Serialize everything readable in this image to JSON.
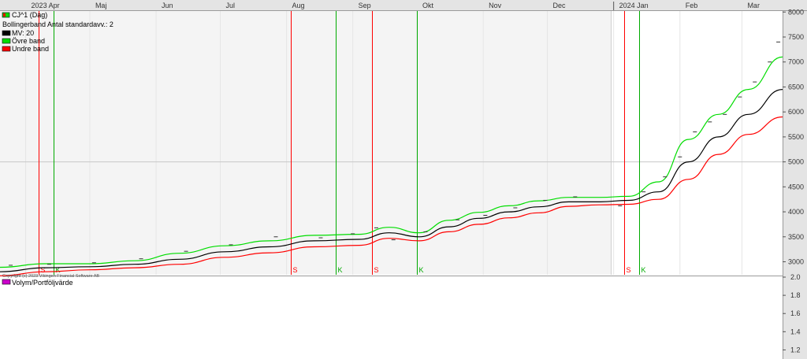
{
  "chart_data": {
    "type": "line",
    "time_axis": {
      "labels": [
        "2023 Apr",
        "Maj",
        "Jun",
        "Jul",
        "Aug",
        "Sep",
        "Okt",
        "Nov",
        "Dec",
        "2024 Jan",
        "Feb",
        "Mar"
      ],
      "label_dates": [
        "2023-04-01",
        "2023-05-01",
        "2023-06-01",
        "2023-07-01",
        "2023-08-01",
        "2023-09-01",
        "2023-10-01",
        "2023-11-01",
        "2023-12-01",
        "2024-01-01",
        "2024-02-01",
        "2024-03-01"
      ],
      "range": [
        "2023-03-20",
        "2024-03-20"
      ]
    },
    "main_panel": {
      "y_ticks": [
        3000,
        3500,
        4000,
        4500,
        5000,
        5500,
        6000,
        6500,
        7000,
        7500,
        8000
      ],
      "ylim": [
        2740,
        8020
      ],
      "reference_line": 5000,
      "legend": {
        "instrument": "CJ^1 (Dag)",
        "indicator": "Bollingerband  Antal standardavv.: 2",
        "entries": [
          {
            "label": "MV: 20",
            "color": "#000000"
          },
          {
            "label": "Övre band",
            "color": "#00dd00"
          },
          {
            "label": "Undre band",
            "color": "#ff0000"
          }
        ]
      },
      "copyright": "Copyright (c) 2023 Vikingen Financial Software AB",
      "series": {
        "x": [
          "2023-03-20",
          "2023-04-10",
          "2023-05-01",
          "2023-05-22",
          "2023-06-12",
          "2023-07-03",
          "2023-07-24",
          "2023-08-14",
          "2023-09-04",
          "2023-09-18",
          "2023-10-02",
          "2023-10-16",
          "2023-10-30",
          "2023-11-13",
          "2023-11-27",
          "2023-12-11",
          "2023-12-25",
          "2024-01-08",
          "2024-01-22",
          "2024-02-05",
          "2024-02-19",
          "2024-03-04",
          "2024-03-20"
        ],
        "mv": [
          2800,
          2880,
          2900,
          2950,
          3050,
          3200,
          3300,
          3420,
          3450,
          3580,
          3500,
          3700,
          3870,
          4000,
          4100,
          4200,
          4200,
          4230,
          4400,
          5000,
          5500,
          5950,
          6450
        ],
        "upper": [
          2890,
          2960,
          2960,
          3020,
          3170,
          3320,
          3420,
          3530,
          3550,
          3690,
          3580,
          3830,
          3990,
          4120,
          4220,
          4290,
          4290,
          4310,
          4600,
          5450,
          5950,
          6450,
          7100
        ],
        "lower": [
          2720,
          2800,
          2840,
          2880,
          2950,
          3090,
          3180,
          3300,
          3330,
          3470,
          3420,
          3600,
          3750,
          3880,
          3980,
          4110,
          4140,
          4150,
          4250,
          4650,
          5150,
          5550,
          5900
        ],
        "price_ticks": [
          {
            "x": "2023-03-25",
            "y": 2930
          },
          {
            "x": "2023-04-12",
            "y": 2950
          },
          {
            "x": "2023-05-03",
            "y": 2980
          },
          {
            "x": "2023-05-25",
            "y": 3060
          },
          {
            "x": "2023-06-15",
            "y": 3210
          },
          {
            "x": "2023-07-06",
            "y": 3340
          },
          {
            "x": "2023-07-27",
            "y": 3500
          },
          {
            "x": "2023-08-17",
            "y": 3480
          },
          {
            "x": "2023-09-01",
            "y": 3560
          },
          {
            "x": "2023-09-12",
            "y": 3680
          },
          {
            "x": "2023-09-20",
            "y": 3440
          },
          {
            "x": "2023-10-05",
            "y": 3600
          },
          {
            "x": "2023-10-20",
            "y": 3840
          },
          {
            "x": "2023-11-02",
            "y": 3930
          },
          {
            "x": "2023-11-16",
            "y": 4080
          },
          {
            "x": "2023-11-30",
            "y": 4230
          },
          {
            "x": "2023-12-14",
            "y": 4300
          },
          {
            "x": "2024-01-04",
            "y": 4120
          },
          {
            "x": "2024-01-15",
            "y": 4400
          },
          {
            "x": "2024-01-25",
            "y": 4700
          },
          {
            "x": "2024-02-01",
            "y": 5100
          },
          {
            "x": "2024-02-08",
            "y": 5600
          },
          {
            "x": "2024-02-15",
            "y": 5800
          },
          {
            "x": "2024-02-22",
            "y": 5950
          },
          {
            "x": "2024-02-29",
            "y": 6300
          },
          {
            "x": "2024-03-07",
            "y": 6600
          },
          {
            "x": "2024-03-14",
            "y": 7000
          },
          {
            "x": "2024-03-18",
            "y": 7400
          }
        ]
      },
      "signals": [
        {
          "date": "2023-04-07",
          "type": "S",
          "color": "#ff0000",
          "label": ""
        },
        {
          "date": "2023-04-14",
          "type": "K",
          "color": "#00aa00",
          "label": ""
        },
        {
          "date": "2023-08-03",
          "type": "S",
          "color": "#ff0000",
          "label": "S"
        },
        {
          "date": "2023-08-24",
          "type": "K",
          "color": "#00aa00",
          "label": "K"
        },
        {
          "date": "2023-09-10",
          "type": "S",
          "color": "#ff0000",
          "label": "S"
        },
        {
          "date": "2023-10-01",
          "type": "K",
          "color": "#00aa00",
          "label": "K"
        },
        {
          "date": "2024-01-06",
          "type": "S",
          "color": "#ff0000",
          "label": "S"
        },
        {
          "date": "2024-01-13",
          "type": "K",
          "color": "#00aa00",
          "label": "K"
        }
      ]
    },
    "lower_panel": {
      "legend": {
        "label": "Volym/Portföljvärde",
        "color": "#cc00cc"
      },
      "y_ticks": [
        1.2,
        1.4,
        1.6,
        1.8,
        2.0
      ],
      "ylim": [
        1.1,
        2.0
      ]
    }
  }
}
